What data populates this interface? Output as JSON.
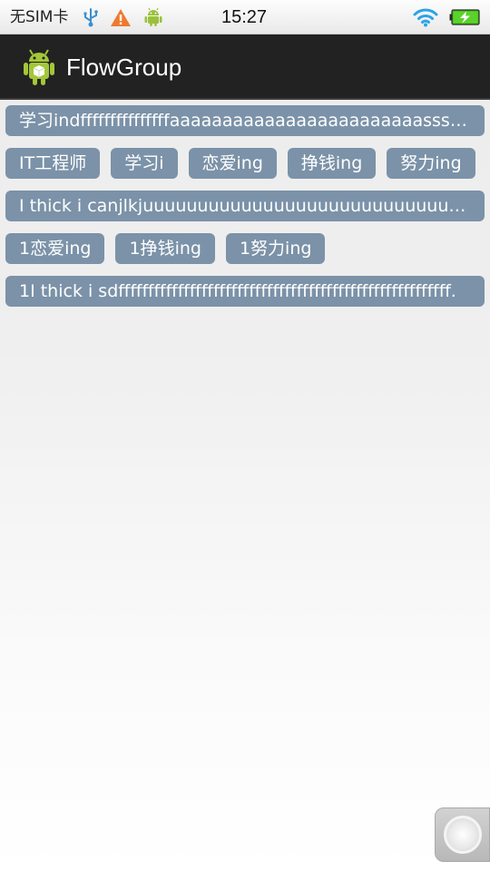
{
  "status_bar": {
    "carrier": "无SIM卡",
    "time": "15:27",
    "icons": [
      "usb-icon",
      "warning-icon",
      "android-debug-icon",
      "wifi-icon",
      "battery-charging-icon"
    ],
    "colors": {
      "warning": "#ee7a2f",
      "android": "#9bc13a",
      "wifi": "#2aa4e8",
      "battery": "#5bd22b"
    }
  },
  "action_bar": {
    "icon": "android-app-icon",
    "title": "FlowGroup",
    "background": "#222222"
  },
  "flow_group": {
    "tag_color": "#7b92a8",
    "tags": [
      "学习indfffffffffffffffaaaaaaaaaaaaaaaaaaaaaaaasssdff.",
      "IT工程师",
      "学习i",
      "恋爱ing",
      "挣钱ing",
      "努力ing",
      "I thick i canjlkjuuuuuuuuuuuuuuuuuuuuuuuuuuuuuuuuuuuuuuuuuuuuu",
      "1恋爱ing",
      "1挣钱ing",
      "1努力ing",
      "1I thick i sdffffffffffffffffffffffffffffffffffffffffffffffffffffffff."
    ]
  },
  "floating_button": {
    "icon": "assistive-touch-icon"
  }
}
